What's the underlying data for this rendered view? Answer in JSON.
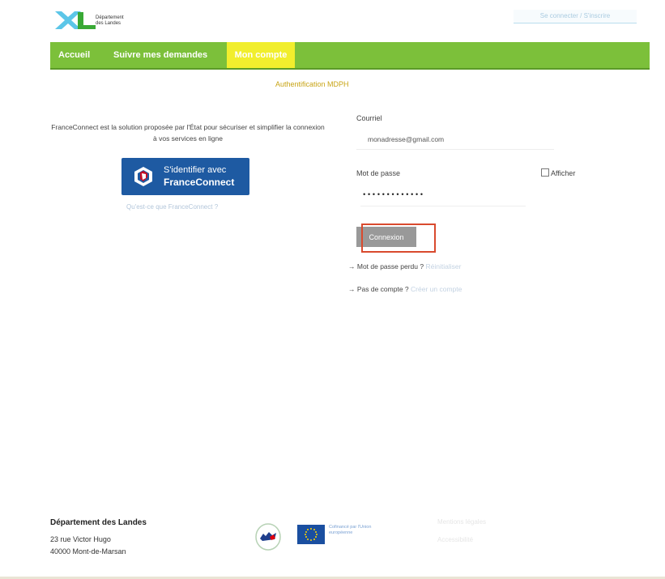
{
  "header": {
    "logo_name": "landes-xl-logo",
    "org_line1": "Département",
    "org_line2": "des Landes",
    "top_link": "Se connecter / S'inscrire"
  },
  "nav": {
    "items": [
      {
        "label": "Accueil"
      },
      {
        "label": "Suivre mes demandes"
      },
      {
        "label": "Mon compte",
        "active": true
      }
    ]
  },
  "notice": "Authentification MDPH",
  "franceconnect": {
    "description": "FranceConnect est la solution proposée par l'État pour sécuriser et simplifier la connexion à vos services en ligne",
    "button_line1": "S'identifier avec",
    "button_line2": "FranceConnect",
    "link": "Qu'est-ce que FranceConnect ?"
  },
  "login": {
    "email_label": "Courriel",
    "email_value": "monadresse@gmail.com",
    "password_label": "Mot de passe",
    "password_value": "•••••••••••••",
    "show_password_label": "Afficher",
    "submit_label": "Connexion",
    "forgot_prefix": "→ Mot de passe perdu ?",
    "forgot_link": "Réinitialiser",
    "signup_prefix": "→ Pas de compte ?",
    "signup_link": "Créer un compte"
  },
  "footer": {
    "org": "Département des Landes",
    "street": "23 rue Victor Hugo",
    "city": "40000 Mont-de-Marsan",
    "eu_text": "Cofinancé par l'Union européenne",
    "link1": "Mentions légales",
    "link2": "Accessibilité"
  },
  "colors": {
    "nav_bg": "#7cc03a",
    "nav_active": "#f1ee2d",
    "notice": "#c8a415",
    "franceconnect_blue": "#1e5aa2",
    "highlight_box": "#d94a2e",
    "button_gray": "#999999"
  }
}
